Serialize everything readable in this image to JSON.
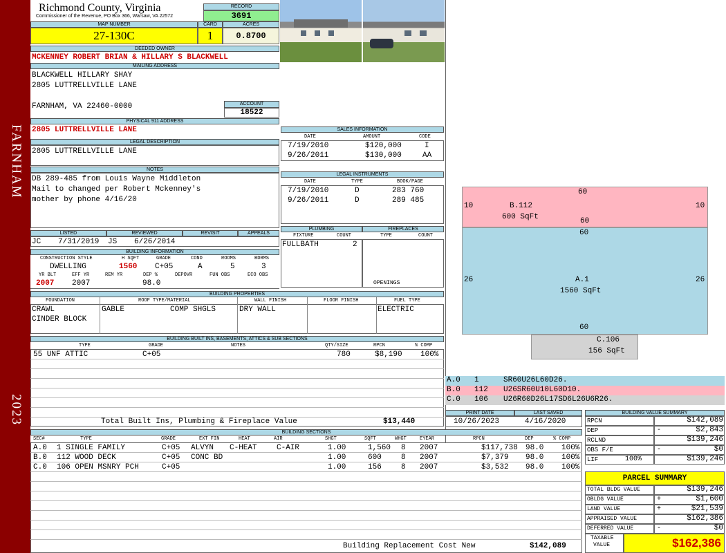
{
  "county": "Richmond County, Virginia",
  "commissioner": "Commissioner of the Revenue, PO Box 366, Warsaw, VA 22572",
  "sidebar": {
    "town": "FARNHAM",
    "year": "2023"
  },
  "record": {
    "label": "RECORD",
    "value": "3691"
  },
  "map": {
    "label": "MAP NUMBER",
    "value": "27-130C"
  },
  "card": {
    "label": "CARD",
    "value": "1"
  },
  "acres": {
    "label": "ACRES",
    "value": "0.8700"
  },
  "owner": {
    "label": "DEEDED OWNER",
    "value": "MCKENNEY ROBERT BRIAN & HILLARY S BLACKWELL"
  },
  "mailing": {
    "label": "MAILING ADDRESS",
    "line1": "BLACKWELL HILLARY SHAY",
    "line2": "2805 LUTTRELLVILLE LANE",
    "line3": "FARNHAM, VA 22460-0000"
  },
  "account": {
    "label": "ACCOUNT",
    "value": "18522"
  },
  "physical": {
    "label": "PHYSICAL 911 ADDRESS",
    "value": "2805 LUTTRELLVILLE LANE"
  },
  "legal": {
    "label": "LEGAL DESCRIPTION",
    "value": "2805 LUTTRELLVILLE LANE"
  },
  "notes": {
    "label": "NOTES",
    "line1": "DB 289-485 from Louis Wayne Middleton",
    "line2": "Mail to changed per Robert Mckenney's",
    "line3": "mother by phone 4/16/20"
  },
  "sales": {
    "label": "SALES INFORMATION",
    "headers": [
      "DATE",
      "AMOUNT",
      "CODE"
    ],
    "rows": [
      [
        "7/19/2010",
        "$120,000",
        "I"
      ],
      [
        "9/26/2011",
        "$130,000",
        "AA"
      ]
    ]
  },
  "legal_instr": {
    "label": "LEGAL INSTRUMENTS",
    "headers": [
      "DATE",
      "TYPE",
      "BOOK/PAGE"
    ],
    "rows": [
      [
        "7/19/2010",
        "D",
        "283 760"
      ],
      [
        "9/26/2011",
        "D",
        "289 485"
      ]
    ]
  },
  "listed": {
    "h_listed": "LISTED",
    "h_reviewed": "REVIEWED",
    "h_revisit": "REVISIT",
    "h_appeals": "APPEALS",
    "listed_by": "JC",
    "listed_date": "7/31/2019",
    "rev_by": "JS",
    "rev_date": "6/26/2014"
  },
  "plumbing": {
    "label": "PLUMBING",
    "h_fixture": "FIXTURE",
    "h_count": "COUNT",
    "fixture": "FULLBATH",
    "count": "2"
  },
  "fireplaces": {
    "label": "FIREPLACES",
    "h_type": "TYPE",
    "h_count": "COUNT",
    "openings": "OPENINGS"
  },
  "bldg_info": {
    "label": "BUILDING INFORMATION",
    "h_style": "CONSTRUCTION STYLE",
    "h_hsqft": "H SQFT",
    "h_grade": "GRADE",
    "h_cond": "COND",
    "h_rooms": "ROOMS",
    "h_bdrms": "BDRMS",
    "style": "DWELLING",
    "hsqft": "1560",
    "grade": "C+05",
    "cond": "A",
    "rooms": "5",
    "bdrms": "3",
    "h_yrblt": "YR BLT",
    "h_effyr": "EFF YR",
    "h_remyr": "REM YR",
    "h_dep": "DEP %",
    "h_depovr": "DEPOVR",
    "h_funobs": "FUN OBS",
    "h_ecoobs": "ECO OBS",
    "yrblt": "2007",
    "effyr": "2007",
    "dep": "98.0"
  },
  "bldg_props": {
    "label": "BUILDING PROPERTIES",
    "h_found": "FOUNDATION",
    "h_roof": "ROOF TYPE/MATERIAL",
    "h_wall": "WALL FINISH",
    "h_floor": "FLOOR FINISH",
    "h_fuel": "FUEL TYPE",
    "found1": "CRAWL",
    "found2": "CINDER BLOCK",
    "roof_type": "GABLE",
    "roof_mat": "COMP SHGLS",
    "wall": "DRY WALL",
    "fuel": "ELECTRIC"
  },
  "builtins": {
    "label": "BUILDING BUILT INS, BASEMENTS, ATTICS & SUB SECTIONS",
    "headers": [
      "TYPE",
      "GRADE",
      "NOTES",
      "QTY/SIZE",
      "RPCN",
      "% COMP"
    ],
    "row": {
      "type": "55 UNF ATTIC",
      "grade": "C+05",
      "qty": "780",
      "rpcn": "$8,190",
      "comp": "100%"
    },
    "total_label": "Total Built Ins, Plumbing & Fireplace Value",
    "total": "$13,440"
  },
  "sections": {
    "label": "BUILDING SECTIONS",
    "headers": [
      "SEC#",
      "TYPE",
      "GRADE",
      "EXT FIN",
      "HEAT",
      "AIR",
      "SHGT",
      "SQFT",
      "WHGT",
      "EYEAR",
      "RPCN",
      "DEP",
      "% COMP"
    ],
    "rows": [
      [
        "A.0",
        "1 SINGLE FAMILY",
        "C+05",
        "ALVYN",
        "C-HEAT",
        "C-AIR",
        "1.00",
        "1,560",
        "8",
        "2007",
        "$117,738",
        "98.0",
        "100%"
      ],
      [
        "B.0",
        "112 WOOD DECK",
        "C+05",
        "CONC BD",
        "",
        "",
        "1.00",
        "600",
        "8",
        "2007",
        "$7,379",
        "98.0",
        "100%"
      ],
      [
        "C.0",
        "106 OPEN MSNRY PCH",
        "C+05",
        "",
        "",
        "",
        "1.00",
        "156",
        "8",
        "2007",
        "$3,532",
        "98.0",
        "100%"
      ]
    ],
    "brcn_label": "Building Replacement Cost New",
    "brcn": "$142,089"
  },
  "sketch": {
    "b_label": "B.112",
    "b_area": "600 SqFt",
    "a_label": "A.1",
    "a_area": "1560 SqFt",
    "c_label": "C.106",
    "c_area": "156 SqFt",
    "dims": {
      "b_top": "60",
      "b_bottom": "60",
      "b_left": "10",
      "b_right": "10",
      "a_top": "60",
      "a_bottom": "60",
      "a_left": "26",
      "a_right": "26"
    },
    "legend": [
      {
        "sec": "A.0",
        "code": "1",
        "path": "SR60U26L60D26.",
        "color": "#add8e6"
      },
      {
        "sec": "B.0",
        "code": "112",
        "path": "U26SR60U10L60D10.",
        "color": "#ffb6c1"
      },
      {
        "sec": "C.0",
        "code": "106",
        "path": "U26R60D26L17SD6L26U6R26.",
        "color": "#d3d3d3"
      }
    ]
  },
  "print": {
    "h_print": "PRINT DATE",
    "h_saved": "LAST SAVED",
    "print_date": "10/26/2023",
    "last_saved": "4/16/2020"
  },
  "bvs": {
    "label": "BUILDING VALUE SUMMARY",
    "rows": [
      {
        "label": "RPCN",
        "op": "",
        "value": "$142,089"
      },
      {
        "label": "DEP",
        "op": "-",
        "value": "$2,843"
      },
      {
        "label": "RCLND",
        "op": "",
        "value": "$139,246"
      },
      {
        "label": "OBS F/E",
        "op": "-",
        "value": "$0"
      },
      {
        "label": "LIF",
        "op": "100%",
        "value": "$139,246"
      }
    ]
  },
  "parcel": {
    "label": "PARCEL SUMMARY",
    "rows": [
      {
        "label": "TOTAL BLDG VALUE",
        "op": "",
        "value": "$139,246"
      },
      {
        "label": "OBLDG VALUE",
        "op": "+",
        "value": "$1,600"
      },
      {
        "label": "LAND VALUE",
        "op": "+",
        "value": "$21,539"
      },
      {
        "label": "APPRAISED VALUE",
        "op": "",
        "value": "$162,386"
      },
      {
        "label": "DEFERRED VALUE",
        "op": "-",
        "value": "$0"
      }
    ],
    "taxable_label1": "TAXABLE",
    "taxable_label2": "VALUE",
    "taxable": "$162,386"
  }
}
